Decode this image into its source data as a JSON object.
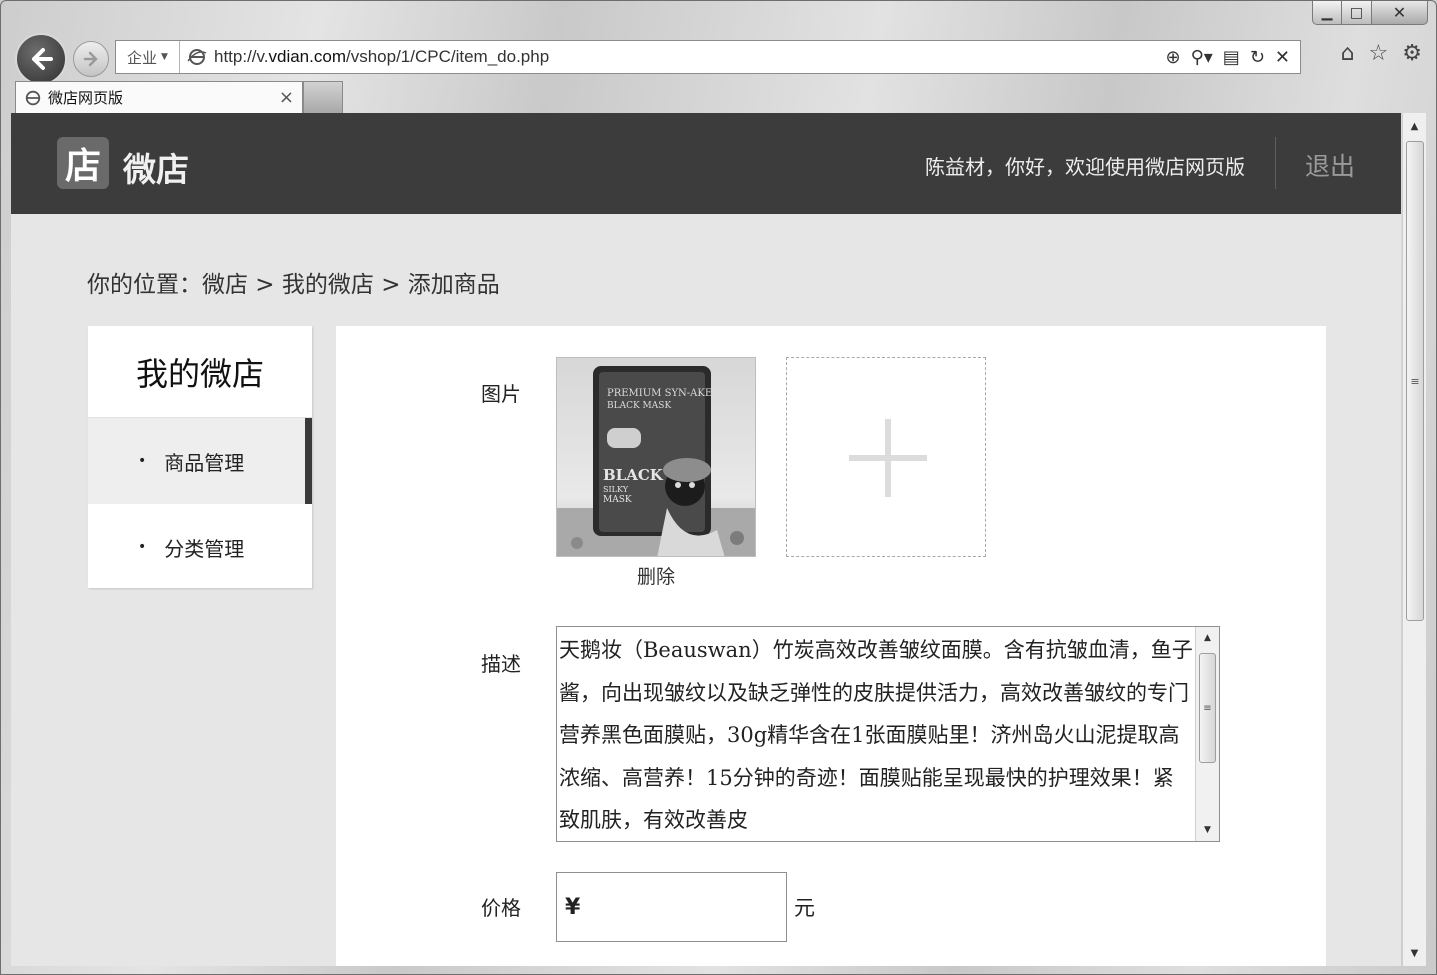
{
  "browser": {
    "window_controls": {
      "minimize": "▁",
      "maximize": "□",
      "close": "✕"
    },
    "zone_label": "企业",
    "url_prefix": "http://v.",
    "url_domain": "vdian.com",
    "url_path": "/vshop/1/CPC/item_do.php",
    "tab_title": "微店网页版",
    "tab_close": "×"
  },
  "header": {
    "logo_char": "店",
    "logo_text": "微店",
    "welcome": "陈益材，你好，欢迎使用微店网页版",
    "logout": "退出"
  },
  "breadcrumb": "你的位置：微店 > 我的微店 > 添加商品",
  "sidebar": {
    "title": "我的微店",
    "items": [
      {
        "label": "商品管理",
        "active": true
      },
      {
        "label": "分类管理",
        "active": false
      }
    ]
  },
  "form": {
    "image_label": "图片",
    "delete_label": "删除",
    "product_image_text": [
      "PREMIUM SYN-AKE",
      "BLACK MASK",
      "BLACK",
      "SILKY",
      "MASK"
    ],
    "desc_label": "描述",
    "description": "天鹅妆（Beauswan）竹炭高效改善皱纹面膜。含有抗皱血清，鱼子酱，向出现皱纹以及缺乏弹性的皮肤提供活力，高效改善皱纹的专门营养黑色面膜贴，30g精华含在1张面膜贴里！济州岛火山泥提取高浓缩、高营养！15分钟的奇迹！面膜贴能呈现最快的护理效果！紧致肌肤，有效改善皮",
    "price_label": "价格",
    "price_prefix": "¥",
    "price_value": "",
    "price_unit": "元"
  }
}
